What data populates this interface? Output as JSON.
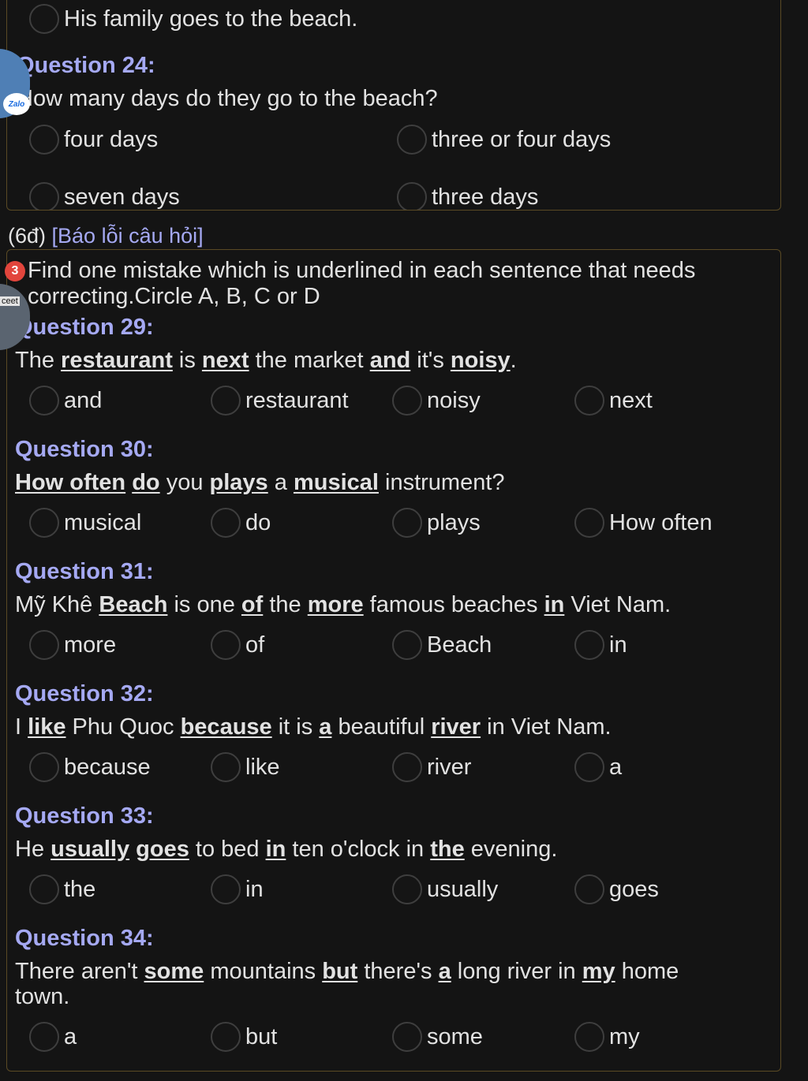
{
  "top_card": {
    "prev_option_label": "His family goes to the beach.",
    "question_title": "Question 24:",
    "question_text": "How many days do they go to the beach?",
    "options": [
      "four days",
      "three or four days",
      "seven days",
      "three days"
    ]
  },
  "report": {
    "points": "(6đ)",
    "link": "[Báo lỗi câu hỏi]"
  },
  "notification_badge": "3",
  "zalo_label": "Zalo",
  "side_bubble_label": "ceet",
  "instructions": {
    "line1": "Find one mistake which is underlined in each sentence that needs",
    "line2": "correcting.Circle A, B, C or D"
  },
  "questions": [
    {
      "title": "Question 29:",
      "sentence": [
        {
          "t": "The "
        },
        {
          "t": "restaurant",
          "u": true
        },
        {
          "t": " is "
        },
        {
          "t": "next",
          "u": true
        },
        {
          "t": " the market "
        },
        {
          "t": "and",
          "u": true
        },
        {
          "t": " it's "
        },
        {
          "t": "noisy",
          "u": true
        },
        {
          "t": "."
        }
      ],
      "options": [
        "and",
        "restaurant",
        "noisy",
        "next"
      ]
    },
    {
      "title": "Question 30:",
      "sentence": [
        {
          "t": "How often",
          "u": true
        },
        {
          "t": " "
        },
        {
          "t": "do",
          "u": true
        },
        {
          "t": " you "
        },
        {
          "t": "plays",
          "u": true
        },
        {
          "t": " a "
        },
        {
          "t": "musical",
          "u": true
        },
        {
          "t": " instrument?"
        }
      ],
      "options": [
        "musical",
        "do",
        "plays",
        "How often"
      ]
    },
    {
      "title": "Question 31:",
      "sentence": [
        {
          "t": "Mỹ Khê "
        },
        {
          "t": "Beach",
          "u": true
        },
        {
          "t": " is one "
        },
        {
          "t": "of",
          "u": true
        },
        {
          "t": " the "
        },
        {
          "t": "more",
          "u": true
        },
        {
          "t": " famous beaches "
        },
        {
          "t": "in",
          "u": true
        },
        {
          "t": " Viet Nam."
        }
      ],
      "options": [
        "more",
        "of",
        "Beach",
        "in"
      ]
    },
    {
      "title": "Question 32:",
      "sentence": [
        {
          "t": "I "
        },
        {
          "t": "like",
          "u": true
        },
        {
          "t": " Phu Quoc "
        },
        {
          "t": "because",
          "u": true
        },
        {
          "t": " it is "
        },
        {
          "t": "a",
          "u": true
        },
        {
          "t": " beautiful "
        },
        {
          "t": "river",
          "u": true
        },
        {
          "t": " in Viet Nam."
        }
      ],
      "options": [
        "because",
        "like",
        "river",
        "a"
      ]
    },
    {
      "title": "Question 33:",
      "sentence": [
        {
          "t": "He "
        },
        {
          "t": "usually",
          "u": true
        },
        {
          "t": " "
        },
        {
          "t": "goes",
          "u": true
        },
        {
          "t": " to bed "
        },
        {
          "t": "in",
          "u": true
        },
        {
          "t": " ten o'clock in "
        },
        {
          "t": "the",
          "u": true
        },
        {
          "t": " evening."
        }
      ],
      "options": [
        "the",
        "in",
        "usually",
        "goes"
      ]
    },
    {
      "title": "Question 34:",
      "sentence": [
        {
          "t": "There aren't "
        },
        {
          "t": "some",
          "u": true
        },
        {
          "t": " mountains "
        },
        {
          "t": "but",
          "u": true
        },
        {
          "t": " there's "
        },
        {
          "t": "a",
          "u": true
        },
        {
          "t": " long river in "
        },
        {
          "t": "my",
          "u": true
        },
        {
          "t": " home"
        }
      ],
      "sentence_line2": "town.",
      "options": [
        "a",
        "but",
        "some",
        "my"
      ]
    }
  ]
}
